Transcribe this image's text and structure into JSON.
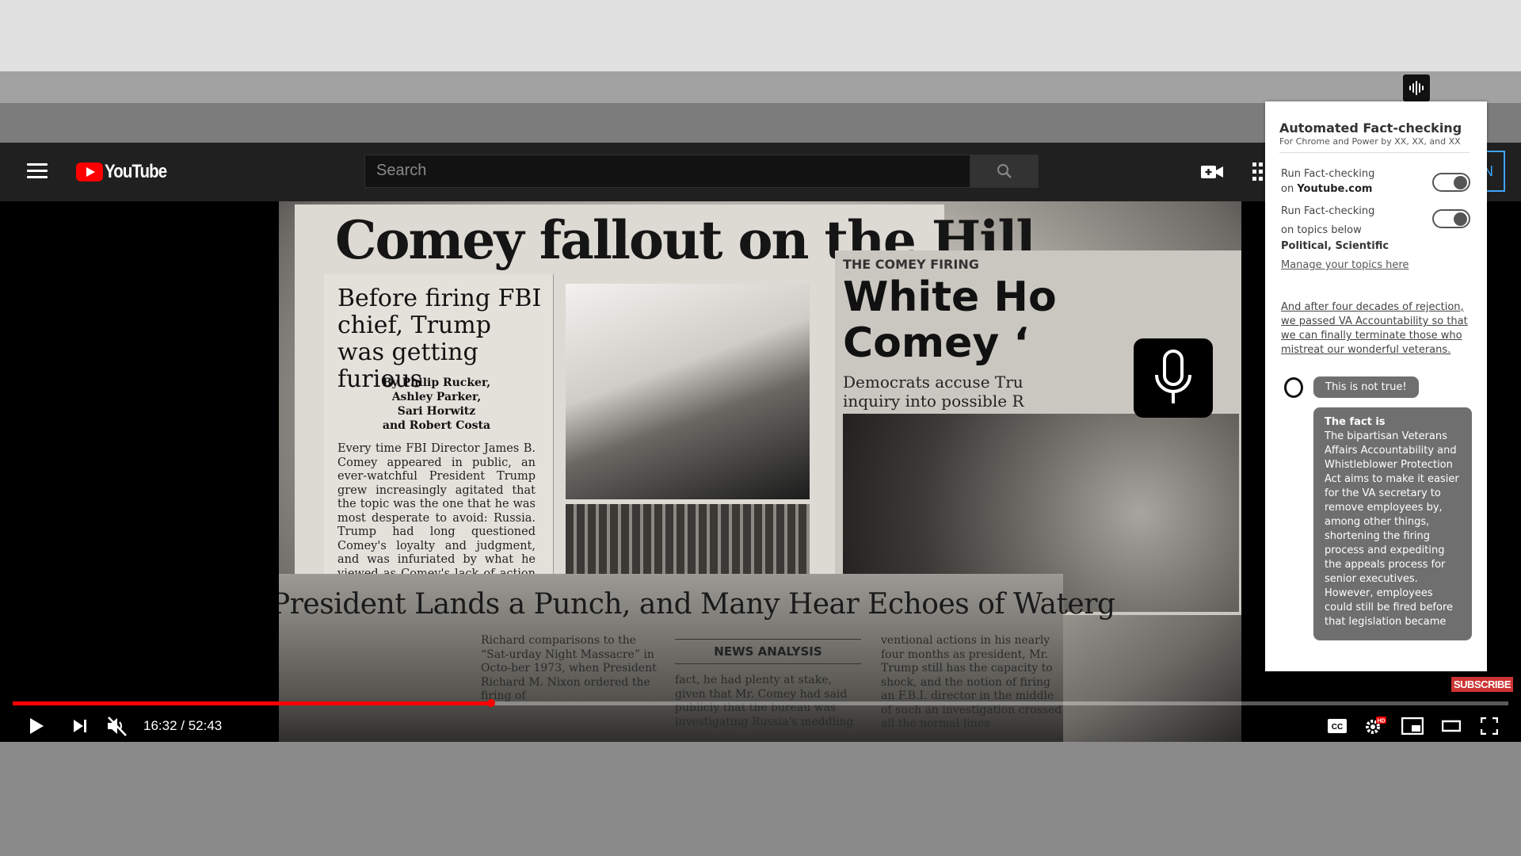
{
  "colors": {
    "brand_red": "#ff0000",
    "header_bg": "#202020",
    "panel_bg": "#ffffff",
    "bubble_bg": "#6f6f6f"
  },
  "header": {
    "search_placeholder": "Search",
    "logo_text": "YouTube",
    "signin_edge": "N"
  },
  "video": {
    "headline_main": "Comey fallout on the Hill",
    "subheadline": "Before firing FBI chief, Trump was getting furious",
    "byline": [
      "By Philip Rucker,",
      "Ashley Parker,",
      "Sari Horwitz",
      "and Robert Costa"
    ],
    "body_text": "Every time FBI Director James B. Comey appeared in public, an ever-watchful President Trump grew increasingly agitated that the topic was the one that he was most desperate to avoid: Russia. Trump had long questioned Comey's loyalty and judgment, and was infuriated by what he viewed as Comey's lack of action in",
    "kicker": "THE COMEY FIRING",
    "headline_second": "White Ho Comey '",
    "headline_second_line1": "White Ho",
    "headline_second_line2": "Comey ‘",
    "dek_line1": "Democrats accuse Tru",
    "dek_line2": "inquiry into possible R",
    "headline_third": "President Lands a Punch, and Many Hear Echoes of Waterg",
    "news_analysis": "NEWS ANALYSIS",
    "col_left": "Richard comparisons to the “Sat-urday Night Massacre” in Octo-ber 1973, when President Richard M. Nixon ordered the firing of",
    "col_mid": "fact, he had plenty at stake, given that Mr. Comey had said publicly that the bureau was investigating Russia's meddling",
    "col_right": "ventional actions in his nearly four months as president, Mr. Trump still has the capacity to shock, and the notion of firing an F.B.I. director in the middle of such an investigation crossed all the normal lines",
    "subscribe": "SUBSCRIBE"
  },
  "controls": {
    "time": "16:32 / 52:43",
    "progress_fraction": 0.32
  },
  "panel": {
    "title": "Automated Fact-checking",
    "subtitle": "For Chrome and Power by XX, XX, and XX",
    "row1_line1": "Run Fact-checking",
    "row1_prefix": "on ",
    "row1_site": "Youtube.com",
    "row2_line1": "Run Fact-checking",
    "row2_line2": "on topics below",
    "topics": "Political, Scientific",
    "manage": "Manage your topics here",
    "quote": "And after four decades of rejection, we passed VA Accountability so that we can finally terminate those who mistreat our  wonderful veterans.",
    "verdict": "This is not true!",
    "fact_heading": "The fact is",
    "fact_body": "The bipartisan Veterans Affairs Accountability and Whistleblower Protection Act aims to make it easier for the VA secretary to remove employees by, among other things, shortening the firing process and expediting the appeals process for senior executives. However, employees could still be fired before that legislation became"
  },
  "toggles": {
    "site_enabled": true,
    "topics_enabled": true
  },
  "icons": [
    "audio-wave-icon",
    "menu-icon",
    "search-icon",
    "video-camera-icon",
    "apps-icon",
    "microphone-icon",
    "play-icon",
    "next-icon",
    "mute-icon",
    "captions-icon",
    "settings-icon",
    "miniplayer-icon",
    "theater-icon",
    "fullscreen-icon",
    "assistant-icon"
  ]
}
